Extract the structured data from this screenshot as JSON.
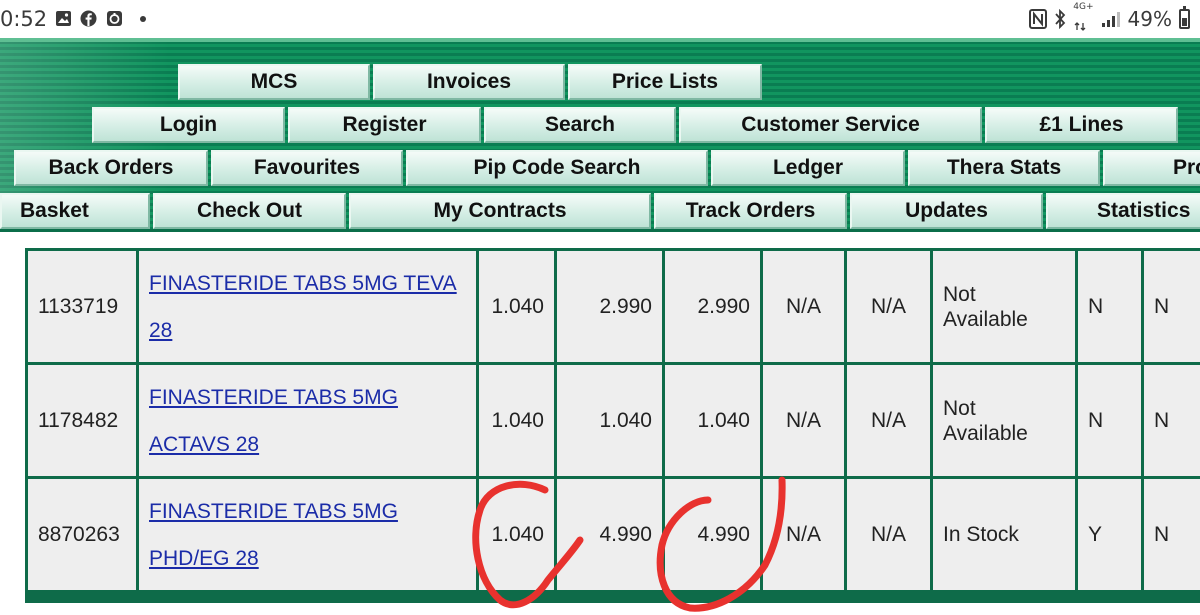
{
  "status_bar": {
    "time": "0:52",
    "network": "4G+",
    "battery": "49%",
    "battery_level": 0.49
  },
  "nav": {
    "row1": [
      "MCS",
      "Invoices",
      "Price Lists"
    ],
    "row2": [
      "Login",
      "Register",
      "Search",
      "Customer Service",
      "£1 Lines"
    ],
    "row3": [
      "Back Orders",
      "Favourites",
      "Pip Code Search",
      "Ledger",
      "Thera Stats",
      "Pro"
    ],
    "row4": [
      "Basket",
      "Check Out",
      "My Contracts",
      "Track Orders",
      "Updates",
      "Statistics"
    ]
  },
  "table": {
    "rows": [
      {
        "code": "1133719",
        "desc1": "FINASTERIDE TABS 5MG TEVA",
        "desc2": "28",
        "v1": "1.040",
        "v2": "2.990",
        "v3": "2.990",
        "c1": "N/A",
        "c2": "N/A",
        "status1": "Not",
        "status2": "Available",
        "f1": "N",
        "f2": "N"
      },
      {
        "code": "1178482",
        "desc1": "FINASTERIDE TABS 5MG",
        "desc2": "ACTAVS 28",
        "v1": "1.040",
        "v2": "1.040",
        "v3": "1.040",
        "c1": "N/A",
        "c2": "N/A",
        "status1": "Not",
        "status2": "Available",
        "f1": "N",
        "f2": "N"
      },
      {
        "code": "8870263",
        "desc1": "FINASTERIDE TABS 5MG",
        "desc2": "PHD/EG 28",
        "v1": "1.040",
        "v2": "4.990",
        "v3": "4.990",
        "c1": "N/A",
        "c2": "N/A",
        "status1": "In Stock",
        "status2": "",
        "f1": "Y",
        "f2": "N"
      }
    ]
  },
  "colors": {
    "banner_green": "#0e8a5c",
    "table_border": "#0e6b49",
    "link": "#1b2ca8",
    "annotation": "#e8322e"
  }
}
